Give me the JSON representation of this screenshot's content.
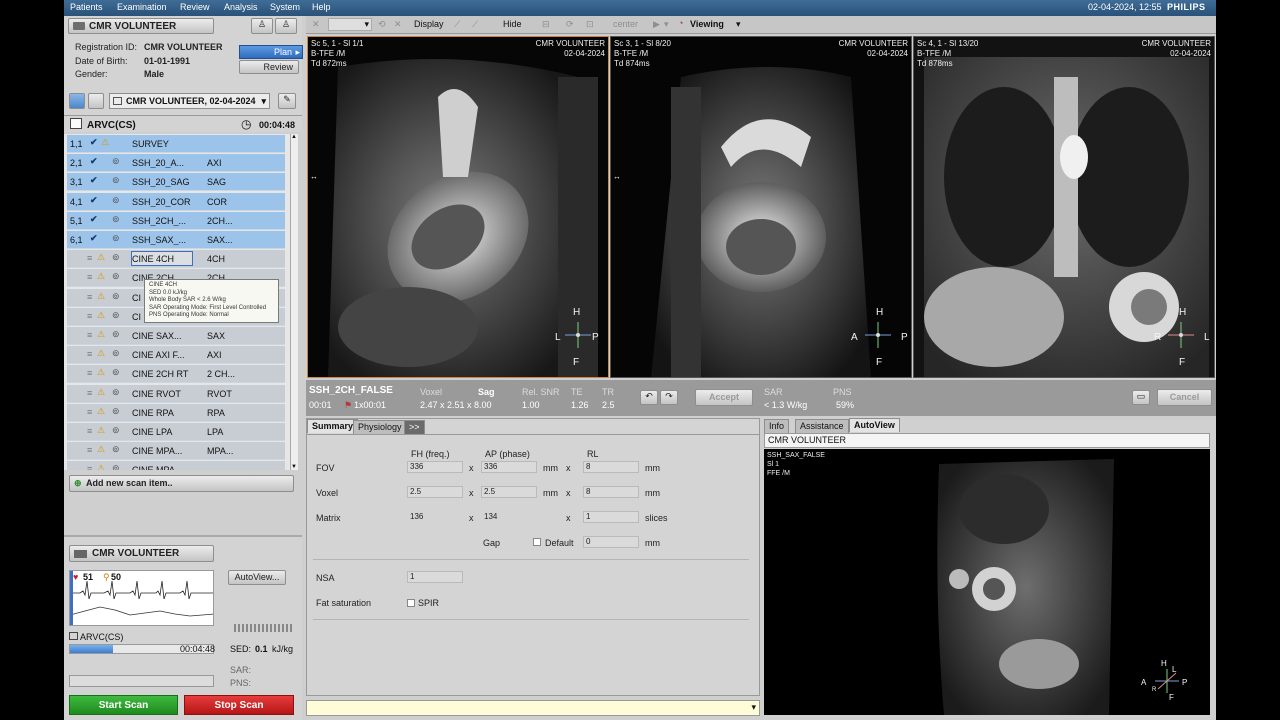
{
  "menu": {
    "items": [
      "Patients",
      "Examination",
      "Review",
      "Analysis",
      "System",
      "Help"
    ],
    "datetime": "02-04-2024, 12:55",
    "brand": "PHILIPS"
  },
  "toolbar": {
    "display_label": "Display",
    "hide_label": "Hide",
    "center_label": "center",
    "viewing_label": "Viewing"
  },
  "patient": {
    "name": "CMR VOLUNTEER",
    "registration_label": "Registration ID:",
    "registration_value": "CMR VOLUNTEER",
    "dob_label": "Date of Birth:",
    "dob_value": "01-01-1991",
    "gender_label": "Gender:",
    "gender_value": "Male",
    "plan_label": "Plan",
    "review_label": "Review",
    "exam_select": "CMR VOLUNTEER, 02-04-2024"
  },
  "examcard": {
    "name": "ARVC(CS)",
    "time": "00:04:48",
    "add_new": "Add new scan item..",
    "rows": [
      {
        "num": "1,1",
        "name": "SURVEY",
        "orient": "",
        "state": "done"
      },
      {
        "num": "2,1",
        "name": "SSH_20_A...",
        "orient": "AXI",
        "state": "done"
      },
      {
        "num": "3,1",
        "name": "SSH_20_SAG",
        "orient": "SAG",
        "state": "done"
      },
      {
        "num": "4,1",
        "name": "SSH_20_COR",
        "orient": "COR",
        "state": "done"
      },
      {
        "num": "5,1",
        "name": "SSH_2CH_...",
        "orient": "2CH...",
        "state": "done"
      },
      {
        "num": "6,1",
        "name": "SSH_SAX_...",
        "orient": "SAX...",
        "state": "done"
      },
      {
        "num": "",
        "name": "CINE 4CH",
        "orient": "4CH",
        "state": "pend"
      },
      {
        "num": "",
        "name": "CINE 2CH",
        "orient": "2CH",
        "state": "pend"
      },
      {
        "num": "",
        "name": "CI",
        "orient": "",
        "state": "pend"
      },
      {
        "num": "",
        "name": "CI",
        "orient": "",
        "state": "pend"
      },
      {
        "num": "",
        "name": "CINE SAX...",
        "orient": "SAX",
        "state": "pend"
      },
      {
        "num": "",
        "name": "CINE AXI F...",
        "orient": "AXI",
        "state": "pend"
      },
      {
        "num": "",
        "name": "CINE 2CH RT",
        "orient": "2 CH...",
        "state": "pend"
      },
      {
        "num": "",
        "name": "CINE RVOT",
        "orient": "RVOT",
        "state": "pend"
      },
      {
        "num": "",
        "name": "CINE RPA",
        "orient": "RPA",
        "state": "pend"
      },
      {
        "num": "",
        "name": "CINE LPA",
        "orient": "LPA",
        "state": "pend"
      },
      {
        "num": "",
        "name": "CINE MPA...",
        "orient": "MPA...",
        "state": "pend"
      },
      {
        "num": "",
        "name": "CINE MPA",
        "orient": "",
        "state": "pend"
      }
    ],
    "tooltip": [
      "CINE 4CH",
      "SED   0.0 kJ/kg",
      "Whole Body SAR  < 2.6 W/kg",
      "SAR Operating Mode: First Level Controlled",
      "PNS Operating Mode: Normal"
    ]
  },
  "monitor": {
    "patient": "CMR VOLUNTEER",
    "hr": "51",
    "resp": "50",
    "autoview": "AutoView...",
    "examcard": "ARVC(CS)",
    "time": "00:04:48",
    "progress": 0.3,
    "sed_label": "SED:",
    "sed_value": "0.1",
    "sed_unit": "kJ/kg",
    "sar_label": "SAR:",
    "pns_label": "PNS:",
    "start": "Start Scan",
    "stop": "Stop Scan"
  },
  "viewports": [
    {
      "tl1": "Sc 5, 1 - Sl 1/1",
      "tl2": "B-TFE  /M",
      "tl3": "Td 872ms",
      "tr1": "CMR VOLUNTEER",
      "tr2": "02-04-2024",
      "top": "H",
      "left": "L",
      "right": "P",
      "bottom": "F"
    },
    {
      "tl1": "Sc 3, 1 - Sl 8/20",
      "tl2": "B-TFE  /M",
      "tl3": "Td 874ms",
      "tr1": "CMR VOLUNTEER",
      "tr2": "02-04-2024",
      "top": "H",
      "left": "A",
      "right": "P",
      "bottom": "F"
    },
    {
      "tl1": "Sc 4, 1 - Sl 13/20",
      "tl2": "B-TFE  /M",
      "tl3": "Td 878ms",
      "tr1": "CMR VOLUNTEER",
      "tr2": "02-04-2024",
      "top": "H",
      "left": "R",
      "right": "L",
      "bottom": "F"
    }
  ],
  "scaninfo": {
    "name": "SSH_2CH_FALSE",
    "time": "00:01",
    "dyn": "1x00:01",
    "voxel_label": "Voxel",
    "voxel_value": "2.47 x 2.51 x 8.00",
    "orient_label": "Sag",
    "rel_label": "Rel. SNR",
    "rel_value": "1.00",
    "te_label": "TE",
    "te_value": "1.26",
    "tr_label": "TR",
    "tr_value": "2.5",
    "accept": "Accept",
    "sar_label": "SAR",
    "sar_value": "< 1.3  W/kg",
    "pns_label": "PNS",
    "pns_value": "59%",
    "cancel": "Cancel"
  },
  "params": {
    "tabs": [
      "Summary",
      "Physiology",
      ">>"
    ],
    "col_fh": "FH (freq.)",
    "col_ap": "AP (phase)",
    "col_rl": "RL",
    "fov_label": "FOV",
    "fov": [
      "336",
      "336",
      "8"
    ],
    "voxel_label": "Voxel",
    "voxel": [
      "2.5",
      "2.5",
      "8"
    ],
    "matrix_label": "Matrix",
    "matrix": [
      "136",
      "134",
      "1"
    ],
    "slices_label": "slices",
    "gap_label": "Gap",
    "default_label": "Default",
    "gap_value": "0",
    "nsa_label": "NSA",
    "nsa_value": "1",
    "fatsat_label": "Fat saturation",
    "spir_label": "SPIR",
    "unit_mm": "mm",
    "times": "x"
  },
  "infopanel": {
    "tabs": [
      "Info",
      "Assistance",
      "AutoView"
    ],
    "patient": "CMR VOLUNTEER",
    "line1": "SSH_SAX_FALSE",
    "line2": "Sl 1",
    "line3": "FFE  /M",
    "top": "H",
    "left": "A",
    "right": "P",
    "bottom": "F",
    "extra1": "L",
    "extra2": "R"
  }
}
